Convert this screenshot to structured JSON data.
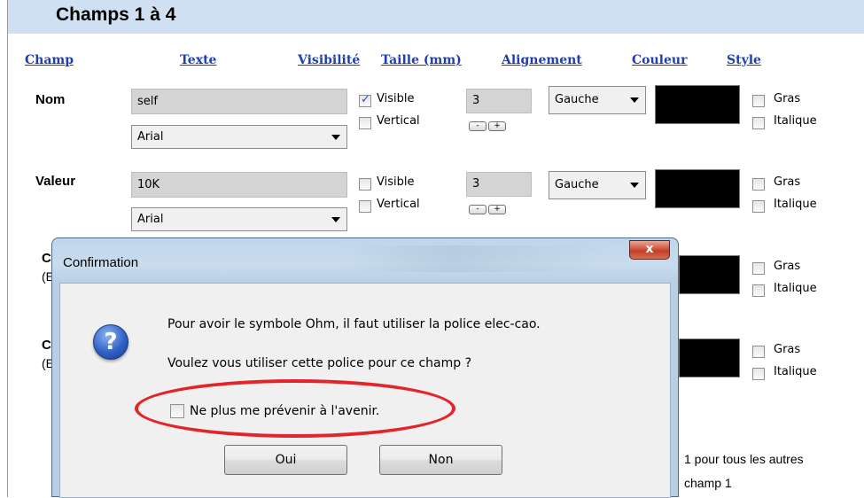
{
  "section_title": "Champs 1 à 4",
  "headers": {
    "champ": "Champ",
    "texte": "Texte",
    "visibilite": "Visibilité",
    "taille": "Taille (mm)",
    "alignement": "Alignement",
    "couleur": "Couleur",
    "style": "Style"
  },
  "rows": [
    {
      "label": "Nom",
      "text_value": "self",
      "font": "Arial",
      "visible_label": "Visible",
      "visible_checked": true,
      "vertical_label": "Vertical",
      "size": "3",
      "spin_minus": "-",
      "spin_plus": "+",
      "align": "Gauche",
      "color": "#000000",
      "bold_label": "Gras",
      "italic_label": "Italique"
    },
    {
      "label": "Valeur",
      "text_value": "10K",
      "font": "Arial",
      "visible_label": "Visible",
      "visible_checked": false,
      "vertical_label": "Vertical",
      "size": "3",
      "spin_minus": "-",
      "spin_plus": "+",
      "align": "Gauche",
      "color": "#000000",
      "bold_label": "Gras",
      "italic_label": "Italique"
    }
  ],
  "hidden_rows": {
    "row3_label_fragment": "C",
    "row3_sub_fragment": "(E",
    "row4_label_fragment": "C",
    "row4_sub_fragment": "(E",
    "bold_label": "Gras",
    "italic_label": "Italique"
  },
  "bottom_text": {
    "line1": "1 pour tous les autres",
    "line2": "champ 1"
  },
  "dialog": {
    "title": "Confirmation",
    "close_glyph": "x",
    "icon": "question-icon",
    "message_line1": "Pour avoir le symbole Ohm, il faut utiliser la police elec-cao.",
    "message_line2": "Voulez vous utiliser cette police pour ce champ ?",
    "checkbox_label": "Ne plus me prévenir  à l'avenir.",
    "checkbox_checked": false,
    "yes_label": "Oui",
    "no_label": "Non"
  },
  "colors": {
    "header_link": "#1f3fb0",
    "title_bar": "#cfe0f2",
    "highlight_ellipse": "#e3242b"
  }
}
